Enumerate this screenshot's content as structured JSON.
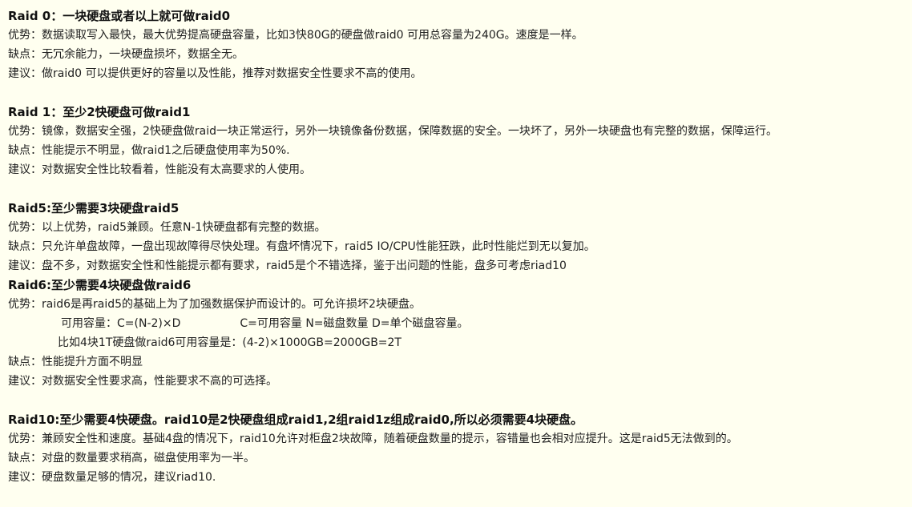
{
  "sections": [
    {
      "title": "Raid 0：一块硬盘或者以上就可做raid0",
      "lines": [
        "优势：数据读取写入最快，最大优势提高硬盘容量，比如3快80G的硬盘做raid0 可用总容量为240G。速度是一样。",
        "缺点：无冗余能力，一块硬盘损坏，数据全无。",
        "建议：做raid0 可以提供更好的容量以及性能，推荐对数据安全性要求不高的使用。"
      ]
    },
    {
      "title": "Raid 1：至少2快硬盘可做raid1",
      "lines": [
        "优势：镜像，数据安全强，2快硬盘做raid一块正常运行，另外一块镜像备份数据，保障数据的安全。一块坏了，另外一块硬盘也有完整的数据，保障运行。",
        "缺点：性能提示不明显，做raid1之后硬盘使用率为50%.",
        "建议：对数据安全性比较看着，性能没有太高要求的人使用。"
      ]
    },
    {
      "title": "Raid5:至少需要3块硬盘raid5",
      "lines": [
        "优势：以上优势，raid5兼顾。任意N-1快硬盘都有完整的数据。",
        "缺点：只允许单盘故障，一盘出现故障得尽快处理。有盘坏情况下，raid5 IO/CPU性能狂跌，此时性能烂到无以复加。",
        "建议：盘不多，对数据安全性和性能提示都有要求，raid5是个不错选择，鉴于出问题的性能，盘多可考虑riad10"
      ]
    },
    {
      "title": "Raid6:至少需要4块硬盘做raid6",
      "advantage": "优势：raid6是再raid5的基础上为了加强数据保护而设计的。可允许损坏2块硬盘。",
      "formula_left": "可用容量：C=(N-2)×D",
      "formula_right": "C=可用容量 N=磁盘数量 D=单个磁盘容量。",
      "example": "比如4块1T硬盘做raid6可用容量是：(4-2)×1000GB=2000GB=2T",
      "lines": [
        "缺点：性能提升方面不明显",
        "建议：对数据安全性要求高，性能要求不高的可选择。"
      ]
    },
    {
      "title": "Raid10:至少需要4快硬盘。raid10是2快硬盘组成raid1,2组raid1z组成raid0,所以必须需要4块硬盘。",
      "lines": [
        "优势：兼顾安全性和速度。基础4盘的情况下，raid10允许对柜盘2块故障，随着硬盘数量的提示，容错量也会相对应提升。这是raid5无法做到的。",
        "缺点：对盘的数量要求稍高，磁盘使用率为一半。",
        "建议：硬盘数量足够的情况，建议riad10."
      ]
    }
  ]
}
